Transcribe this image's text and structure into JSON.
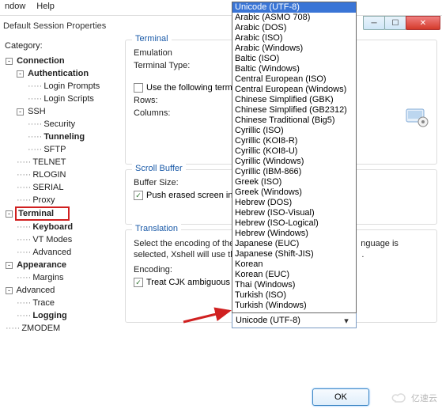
{
  "menubar": {
    "window": "ndow",
    "help": "Help"
  },
  "title": "Default Session Properties",
  "category_label": "Category:",
  "tree": {
    "connection": "Connection",
    "authentication": "Authentication",
    "login_prompts": "Login Prompts",
    "login_scripts": "Login Scripts",
    "ssh": "SSH",
    "security": "Security",
    "tunneling": "Tunneling",
    "sftp": "SFTP",
    "telnet": "TELNET",
    "rlogin": "RLOGIN",
    "serial": "SERIAL",
    "proxy": "Proxy",
    "terminal": "Terminal",
    "keyboard": "Keyboard",
    "vt_modes": "VT Modes",
    "advanced_t": "Advanced",
    "appearance": "Appearance",
    "margins": "Margins",
    "advanced": "Advanced",
    "trace": "Trace",
    "logging": "Logging",
    "zmodem": "ZMODEM"
  },
  "groups": {
    "terminal": {
      "title": "Terminal",
      "emulation": "Emulation",
      "terminal_type": "Terminal Type:",
      "use_following": "Use the following term",
      "rows": "Rows:",
      "columns": "Columns:"
    },
    "scroll": {
      "title": "Scroll Buffer",
      "buffer_size": "Buffer Size:",
      "push_erased": "Push erased screen int"
    },
    "translation": {
      "title": "Translation",
      "desc1": "Select the encoding of the",
      "desc2": "selected, Xshell will use th",
      "desc_tail1": "nguage is",
      "desc_tail2": ".",
      "encoding": "Encoding:",
      "treat_cjk": "Treat CJK ambiguous characters as wide character"
    }
  },
  "encoding_selected": "Unicode (UTF-8)",
  "encoding_options": [
    "Unicode (UTF-8)",
    "Arabic (ASMO 708)",
    "Arabic (DOS)",
    "Arabic (ISO)",
    "Arabic (Windows)",
    "Baltic (ISO)",
    "Baltic (Windows)",
    "Central European (ISO)",
    "Central European (Windows)",
    "Chinese Simplified (GBK)",
    "Chinese Simplified (GB2312)",
    "Chinese Traditional (Big5)",
    "Cyrillic (ISO)",
    "Cyrillic (KOI8-R)",
    "Cyrillic (KOI8-U)",
    "Cyrillic (Windows)",
    "Cyrillic (IBM-866)",
    "Greek (ISO)",
    "Greek (Windows)",
    "Hebrew (DOS)",
    "Hebrew (ISO-Visual)",
    "Hebrew (ISO-Logical)",
    "Hebrew (Windows)",
    "Japanese (EUC)",
    "Japanese (Shift-JIS)",
    "Korean",
    "Korean (EUC)",
    "Thai (Windows)",
    "Turkish (ISO)",
    "Turkish (Windows)"
  ],
  "ok": "OK",
  "watermark": "亿速云"
}
